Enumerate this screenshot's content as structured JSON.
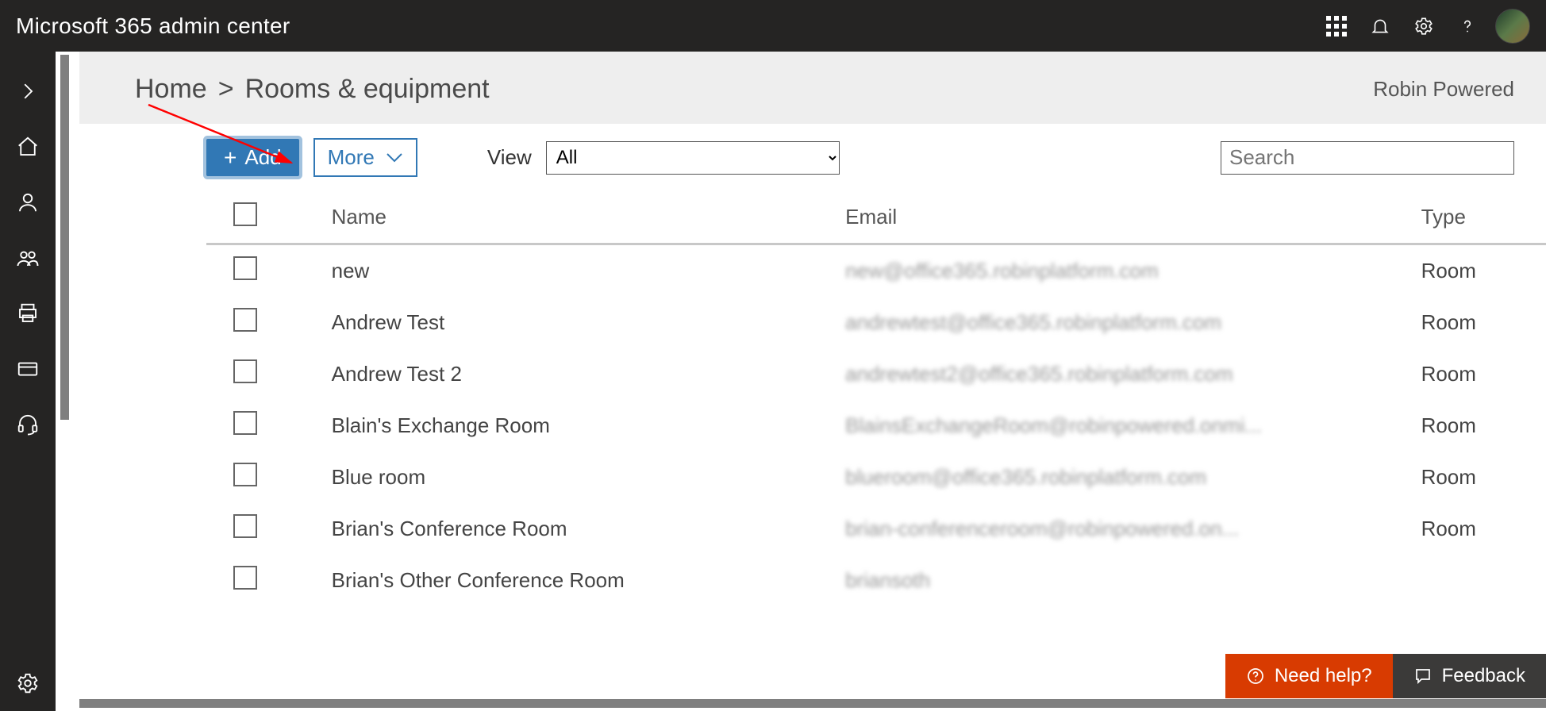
{
  "topbar": {
    "title": "Microsoft 365 admin center"
  },
  "breadcrumb": {
    "home": "Home",
    "sep": ">",
    "page": "Rooms & equipment"
  },
  "tenant": "Robin Powered",
  "toolbar": {
    "add_label": "Add",
    "more_label": "More",
    "view_label": "View",
    "view_value": "All",
    "search_placeholder": "Search"
  },
  "table": {
    "columns": {
      "name": "Name",
      "email": "Email",
      "type": "Type"
    },
    "rows": [
      {
        "name": "new",
        "email": "new@office365.robinplatform.com",
        "type": "Room"
      },
      {
        "name": "Andrew Test",
        "email": "andrewtest@office365.robinplatform.com",
        "type": "Room"
      },
      {
        "name": "Andrew Test 2",
        "email": "andrewtest2@office365.robinplatform.com",
        "type": "Room"
      },
      {
        "name": "Blain's Exchange Room",
        "email": "BlainsExchangeRoom@robinpowered.onmi...",
        "type": "Room"
      },
      {
        "name": "Blue room",
        "email": "blueroom@office365.robinplatform.com",
        "type": "Room"
      },
      {
        "name": "Brian's Conference Room",
        "email": "brian-conferenceroom@robinpowered.on...",
        "type": "Room"
      },
      {
        "name": "Brian's Other Conference Room",
        "email": "briansoth",
        "type": ""
      }
    ]
  },
  "bottom": {
    "need_help": "Need help?",
    "feedback": "Feedback"
  }
}
